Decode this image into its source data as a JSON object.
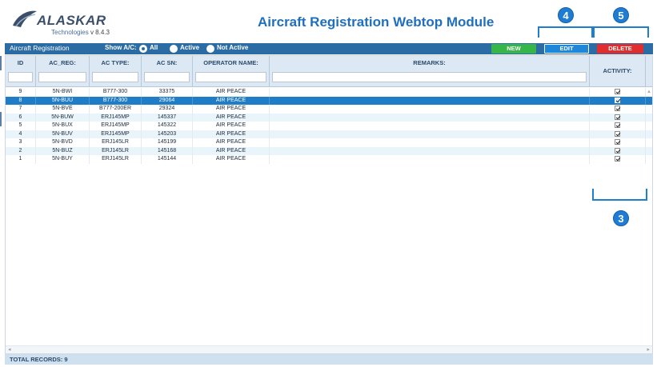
{
  "app": {
    "brand": "ALASKAR",
    "brand_sub": "Technologies",
    "version": "v 8.4.3",
    "title": "Aircraft Registration Webtop Module"
  },
  "toolbar": {
    "title": "Aircraft Registration",
    "show_label": "Show A/C:",
    "radios": [
      "All",
      "Active",
      "Not Active"
    ],
    "selected": "All",
    "new_label": "NEW",
    "edit_label": "EDIT",
    "delete_label": "DELETE",
    "colors": {
      "bar": "#2a6ca3",
      "new": "#36b649",
      "edit": "#1f87d9",
      "delete": "#e12d2d"
    }
  },
  "callouts": {
    "edit": "4",
    "delete": "5",
    "activity": "3"
  },
  "grid": {
    "columns": [
      "ID",
      "AC_REG:",
      "AC TYPE:",
      "AC SN:",
      "OPERATOR NAME:",
      "REMARKS:",
      "ACTIVITY:"
    ],
    "rows": [
      {
        "id": "9",
        "reg": "5N-BWI",
        "type": "B777-300",
        "sn": "33375",
        "op": "AIR PEACE",
        "remarks": "",
        "active": true
      },
      {
        "id": "8",
        "reg": "5N-BUU",
        "type": "B777-300",
        "sn": "29064",
        "op": "AIR PEACE",
        "remarks": "",
        "active": true
      },
      {
        "id": "7",
        "reg": "5N-BVE",
        "type": "B777-200ER",
        "sn": "29324",
        "op": "AIR PEACE",
        "remarks": "",
        "active": true
      },
      {
        "id": "6",
        "reg": "5N-BUW",
        "type": "ERJ145MP",
        "sn": "145337",
        "op": "AIR PEACE",
        "remarks": "",
        "active": true
      },
      {
        "id": "5",
        "reg": "5N-BUX",
        "type": "ERJ145MP",
        "sn": "145322",
        "op": "AIR PEACE",
        "remarks": "",
        "active": true
      },
      {
        "id": "4",
        "reg": "5N-BUV",
        "type": "ERJ145MP",
        "sn": "145203",
        "op": "AIR PEACE",
        "remarks": "",
        "active": true
      },
      {
        "id": "3",
        "reg": "5N-BVD",
        "type": "ERJ145LR",
        "sn": "145199",
        "op": "AIR PEACE",
        "remarks": "",
        "active": true
      },
      {
        "id": "2",
        "reg": "5N-BUZ",
        "type": "ERJ145LR",
        "sn": "145168",
        "op": "AIR PEACE",
        "remarks": "",
        "active": true
      },
      {
        "id": "1",
        "reg": "5N-BUY",
        "type": "ERJ145LR",
        "sn": "145144",
        "op": "AIR PEACE",
        "remarks": "",
        "active": true
      }
    ],
    "selected_id": "8"
  },
  "footer": {
    "total": "TOTAL RECORDS: 9"
  }
}
